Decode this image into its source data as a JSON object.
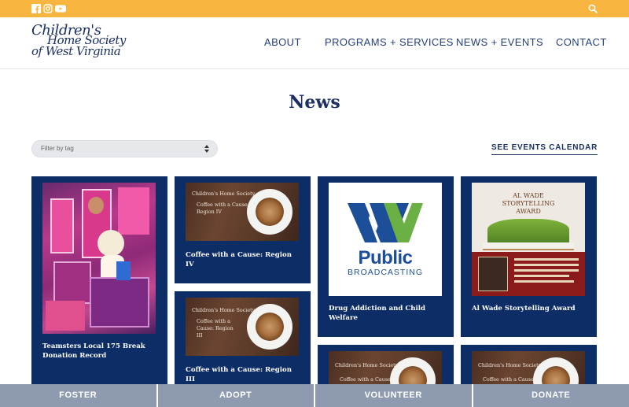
{
  "social": {
    "icons": [
      "facebook-icon",
      "instagram-icon",
      "youtube-icon"
    ]
  },
  "logo": {
    "line1": "Children's",
    "line2": "Home Society",
    "line3": "of West Virginia"
  },
  "nav": [
    {
      "label": "ABOUT"
    },
    {
      "label": "PROGRAMS + SERVICES"
    },
    {
      "label": "NEWS + EVENTS"
    },
    {
      "label": "CONTACT"
    }
  ],
  "page": {
    "title": "News"
  },
  "filter": {
    "placeholder": "Filter by tag"
  },
  "events_link": "SEE EVENTS CALENDAR",
  "cards": [
    {
      "caption": "Teamsters Local 175 Break Donation Record"
    },
    {
      "caption": "Coffee with a Cause: Region IV",
      "img_org": "Children's Home Society",
      "img_text": "Coffee with a Cause: Region IV"
    },
    {
      "caption": "Coffee with a Cause: Region III",
      "img_org": "Children's Home Society",
      "img_text": "Coffee with a Cause: Region III"
    },
    {
      "caption": "Drug Addiction and Child Welfare",
      "logo_word": "Public",
      "logo_sub": "BROADCASTING"
    },
    {
      "caption": "Al Wade Storytelling Award",
      "award_title_1": "AL WADE",
      "award_title_2": "STORYTELLING",
      "award_title_3": "AWARD"
    },
    {
      "img_org": "Children's Home Society",
      "img_text": "Coffee with a Cause:"
    },
    {
      "img_org": "Children's Home Society",
      "img_text": "Coffee with a Cause:"
    }
  ],
  "actions": [
    {
      "label": "FOSTER"
    },
    {
      "label": "ADOPT"
    },
    {
      "label": "VOLUNTEER"
    },
    {
      "label": "DONATE"
    }
  ],
  "colors": {
    "topbar": "#f8b53f",
    "navy": "#0d2d66",
    "action_bar": "#8e9ab0"
  }
}
